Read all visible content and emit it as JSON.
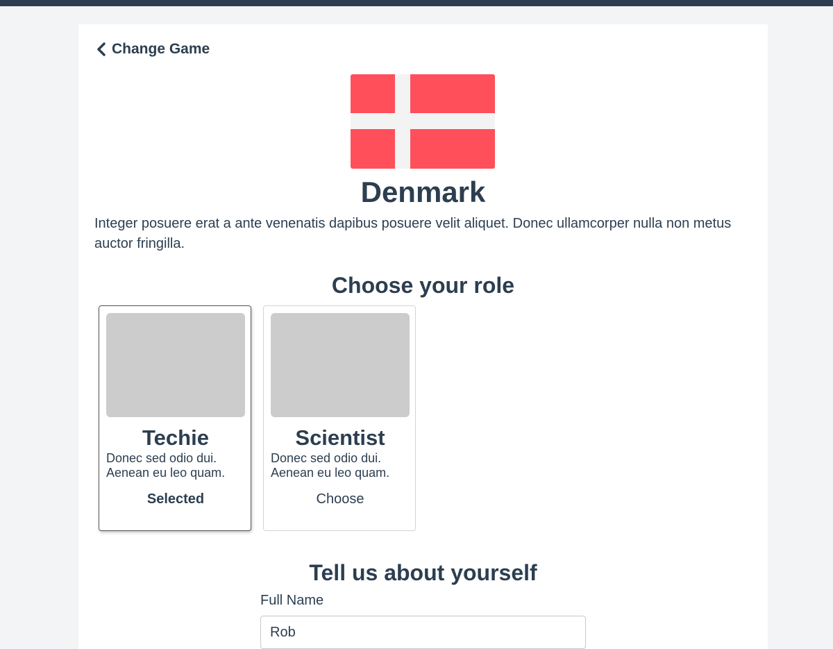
{
  "header": {
    "back_label": "Change Game"
  },
  "country": {
    "name": "Denmark",
    "description": "Integer posuere erat a ante venenatis dapibus posuere velit aliquet. Donec ullamcorper nulla non metus auctor fringilla.",
    "flag_colors": {
      "field": "#ff4f5a",
      "cross": "#f3f3f3"
    }
  },
  "roles": {
    "heading": "Choose your role",
    "items": [
      {
        "name": "Techie",
        "description": "Donec sed odio dui. Aenean eu leo quam.",
        "action": "Selected",
        "selected": true
      },
      {
        "name": "Scientist",
        "description": "Donec sed odio dui. Aenean eu leo quam.",
        "action": "Choose",
        "selected": false
      }
    ]
  },
  "about": {
    "heading": "Tell us about yourself",
    "full_name_label": "Full Name",
    "full_name_value": "Rob"
  },
  "colors": {
    "top_bar": "#2d3e50",
    "text": "#2c3e50",
    "page_background": "#f3f4f6"
  }
}
